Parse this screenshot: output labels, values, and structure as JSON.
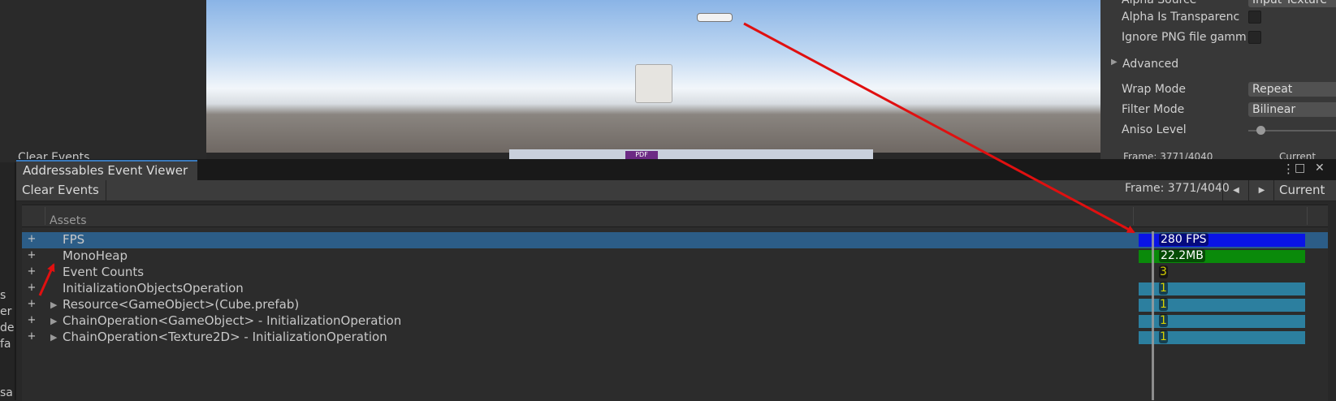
{
  "background": {
    "left_fragments": [
      "s",
      "er",
      "de",
      "fa",
      "sa"
    ],
    "ghost_clear_label": "Clear Events",
    "dock_pdf_label": "PDF",
    "inspector": {
      "alpha_source_label": "Alpha Source",
      "alpha_source_value": "Input Texture",
      "alpha_is_transparency_label": "Alpha Is Transparenc",
      "ignore_png_gamma_label": "Ignore PNG file gamm",
      "advanced_label": "Advanced",
      "wrap_mode_label": "Wrap Mode",
      "wrap_mode_value": "Repeat",
      "filter_mode_label": "Filter Mode",
      "filter_mode_value": "Bilinear",
      "aniso_level_label": "Aniso Level",
      "frame_text": "Frame: 3771/4040",
      "current_label": "Current"
    }
  },
  "window": {
    "tab_title": "Addressables Event Viewer",
    "menu_icon": "⋮",
    "maximize_icon": "□",
    "close_icon": "✕"
  },
  "toolbar": {
    "clear_label": "Clear Events",
    "frame_text": "Frame: 3771/4040",
    "prev_icon": "◀",
    "next_icon": "▶",
    "current_label": "Current"
  },
  "tree": {
    "column_header": "Assets",
    "rows": [
      {
        "label": "FPS",
        "expander": false,
        "bar_color": "#0a14e6",
        "bar_text": "280 FPS",
        "selected": true
      },
      {
        "label": "MonoHeap",
        "expander": false,
        "bar_color": "#0a8a0a",
        "bar_text": "22.2MB",
        "selected": false
      },
      {
        "label": "Event Counts",
        "expander": false,
        "bar_color": "",
        "bar_text": "3",
        "selected": false
      },
      {
        "label": "InitializationObjectsOperation",
        "expander": false,
        "bar_color": "#2c7f9f",
        "bar_text": "1",
        "selected": false
      },
      {
        "label": "Resource<GameObject>(Cube.prefab)",
        "expander": true,
        "bar_color": "#2c7f9f",
        "bar_text": "1",
        "selected": false
      },
      {
        "label": "ChainOperation<GameObject> - InitializationOperation",
        "expander": true,
        "bar_color": "#2c7f9f",
        "bar_text": "1",
        "selected": false
      },
      {
        "label": "ChainOperation<Texture2D> - InitializationOperation",
        "expander": true,
        "bar_color": "#2c7f9f",
        "bar_text": "1",
        "selected": false
      }
    ],
    "plus_symbol": "+",
    "expander_symbol": "▶"
  },
  "colors": {
    "selection": "#2c5d87",
    "annotation_arrow": "#e01010"
  }
}
